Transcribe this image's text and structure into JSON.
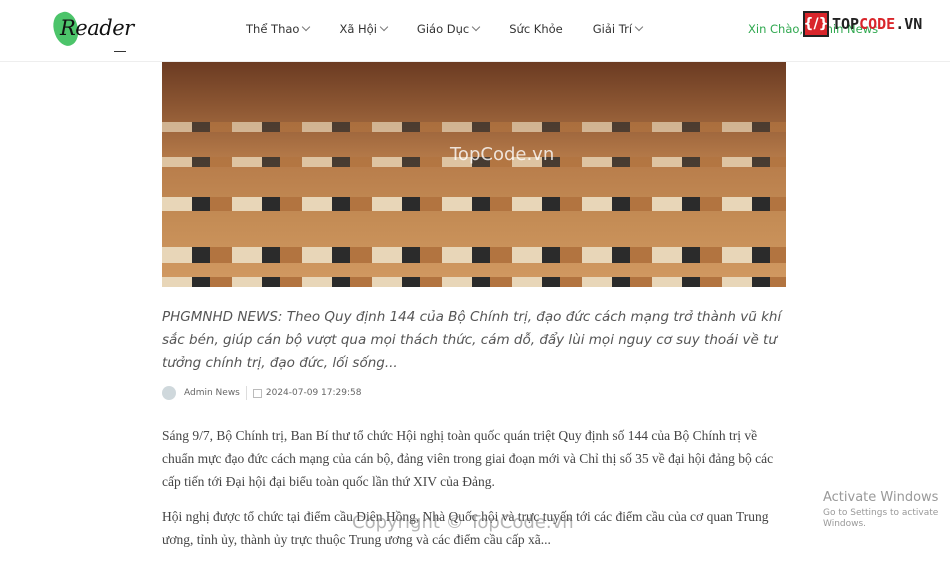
{
  "header": {
    "logo_text": "Reader",
    "nav": [
      {
        "label": "Thể Thao",
        "dropdown": true
      },
      {
        "label": "Xã Hội",
        "dropdown": true
      },
      {
        "label": "Giáo Dục",
        "dropdown": true
      },
      {
        "label": "Sức Khỏe",
        "dropdown": false
      },
      {
        "label": "Giải Trí",
        "dropdown": true
      }
    ],
    "greeting": "Xin Chào, Admin News"
  },
  "watermark_logo": {
    "brand": "TOPCODE.VN"
  },
  "article": {
    "lead": "PHGMNHD NEWS: Theo Quy định 144 của Bộ Chính trị, đạo đức cách mạng trở thành vũ khí sắc bén, giúp cán bộ vượt qua mọi thách thức, cám dỗ, đẩy lùi mọi nguy cơ suy thoái về tư tưởng chính trị, đạo đức, lối sống...",
    "author": "Admin News",
    "date": "2024-07-09 17:29:58",
    "paragraphs": [
      "Sáng 9/7, Bộ Chính trị, Ban Bí thư tổ chức Hội nghị toàn quốc quán triệt Quy định số 144 của Bộ Chính trị về chuẩn mực đạo đức cách mạng của cán bộ, đảng viên trong giai đoạn mới và Chỉ thị số 35 về đại hội đảng bộ các cấp tiến tới Đại hội đại biểu toàn quốc lần thứ XIV của Đảng.",
      "Hội nghị được tổ chức tại điểm cầu Diên Hồng, Nhà Quốc hội và trực tuyến tới các điểm cầu của cơ quan Trung ương, tỉnh ủy, thành ủy trực thuộc Trung ương và các điểm cầu cấp xã..."
    ]
  },
  "watermarks": {
    "image": "TopCode.vn",
    "copyright": "Copyright © TopCode.vn"
  },
  "os_notice": {
    "title": "Activate Windows",
    "subtitle": "Go to Settings to activate Windows."
  }
}
